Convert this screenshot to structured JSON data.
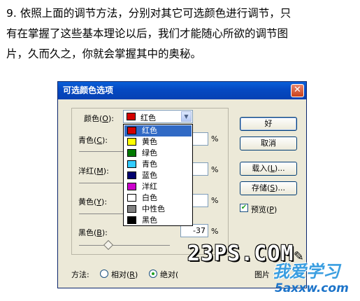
{
  "paragraph": {
    "line1": "9. 依照上面的调节方法，分别对其它可选颜色进行调节，只",
    "line2": "有在掌握了这些基本理论以后，我们才能随心所欲的调节图",
    "line3": "片，久而久之，你就会掌握其中的奥秘。"
  },
  "dialog": {
    "title": "可选颜色选项",
    "close": "✕",
    "color_label": "颜色(",
    "color_key": "O",
    "color_value": "红色",
    "combo_arrow": "▼",
    "sliders": [
      {
        "label": "青色(",
        "key": "C",
        "value": "",
        "unit": "%"
      },
      {
        "label": "洋红(",
        "key": "M",
        "value": "",
        "unit": "%"
      },
      {
        "label": "黄色(",
        "key": "Y",
        "value": "",
        "unit": "%"
      },
      {
        "label": "黑色(",
        "key": "B",
        "value": "-37",
        "unit": "%",
        "thumb_fraction": 0.32
      }
    ],
    "dropdown": [
      {
        "label": "红色",
        "color": "#d40000",
        "selected": true
      },
      {
        "label": "黄色",
        "color": "#ffff00"
      },
      {
        "label": "绿色",
        "color": "#007a00"
      },
      {
        "label": "青色",
        "color": "#33ccff"
      },
      {
        "label": "蓝色",
        "color": "#00006e"
      },
      {
        "label": "洋红",
        "color": "#cc00cc"
      },
      {
        "label": "白色",
        "color": "#ffffff"
      },
      {
        "label": "中性色",
        "color": "#808080"
      },
      {
        "label": "黑色",
        "color": "#000000"
      }
    ],
    "buttons": {
      "ok": "好",
      "cancel": "取消",
      "load": "载入(",
      "load_key": "L",
      "load_suffix": ")...",
      "save": "存储(",
      "save_key": "S",
      "save_suffix": ")..."
    },
    "preview": {
      "label": "预览(",
      "key": "P",
      "checked": true,
      "check_mark": "✔"
    },
    "method": {
      "label": "方法:",
      "relative": "相对(",
      "relative_key": "R",
      "absolute": "绝对(",
      "selected": "absolute"
    },
    "cut_text": "图片"
  },
  "watermark": {
    "site": "23PS.COM",
    "pencil": "✎",
    "logo_cn": "我爱学习",
    "logo_url": "5axxw.com"
  },
  "accent": "#0a5fd8"
}
